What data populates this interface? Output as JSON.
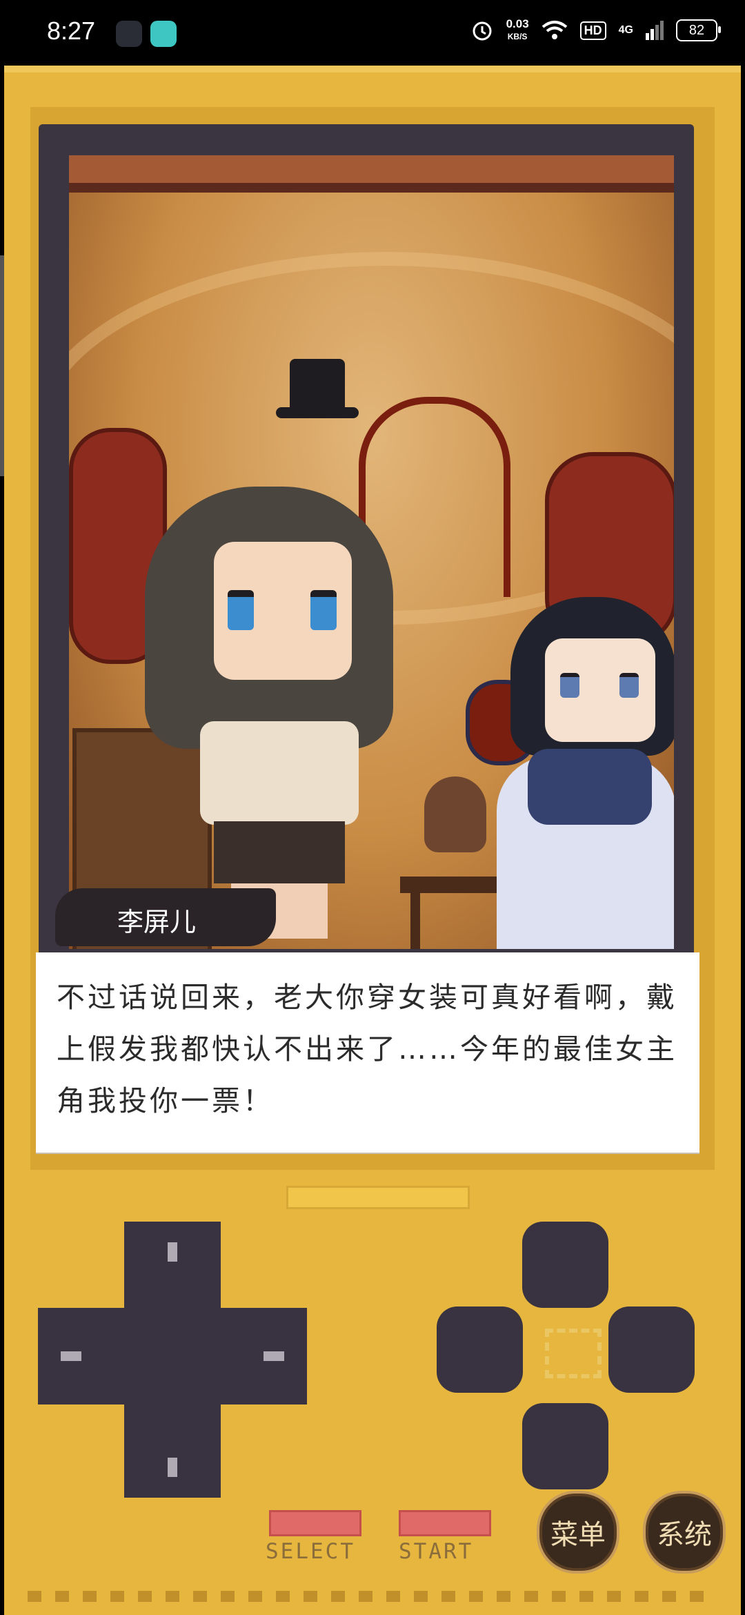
{
  "status_bar": {
    "time": "8:27",
    "net_speed": "0.03",
    "net_unit": "KB/S",
    "hd": "HD",
    "signal": "4G",
    "battery": "82",
    "icons": [
      "alarm-icon",
      "wifi-icon",
      "signal-icon",
      "battery-icon"
    ]
  },
  "scene": {
    "speaker_name": "李屏儿",
    "dialogue": "不过话说回来，老大你穿女装可真好看啊，戴上假发我都快认不出来了……今年的最佳女主角我投你一票！"
  },
  "controls": {
    "select_label": "SELECT",
    "start_label": "START",
    "menu_label": "菜单",
    "system_label": "系统"
  },
  "colors": {
    "console": "#e6b63e",
    "button_dark": "#393341",
    "pill_red": "#e06a68"
  }
}
